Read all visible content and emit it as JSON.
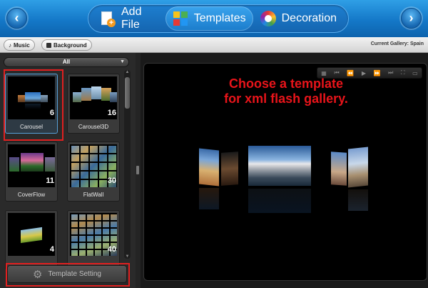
{
  "nav": {
    "back_icon": "chevron-left-icon",
    "forward_icon": "chevron-right-icon"
  },
  "tabs": [
    {
      "label": "Add File",
      "icon": "add-file-icon"
    },
    {
      "label": "Templates",
      "icon": "templates-icon",
      "active": true
    },
    {
      "label": "Decoration",
      "icon": "decoration-icon"
    }
  ],
  "subbar": {
    "music_label": "Music",
    "background_label": "Background",
    "gallery_label": "Current Gallery: Spain"
  },
  "filter": {
    "selected": "All"
  },
  "templates": [
    {
      "name": "Carousel",
      "count": "6",
      "selected": true
    },
    {
      "name": "Carousel3D",
      "count": "16"
    },
    {
      "name": "CoverFlow",
      "count": "11"
    },
    {
      "name": "FlatWall",
      "count": "30"
    },
    {
      "name": "",
      "count": "4"
    },
    {
      "name": "",
      "count": "40"
    }
  ],
  "setting_button": {
    "label": "Template Setting"
  },
  "preview": {
    "hint_line1": "Choose a template",
    "hint_line2": "for xml flash gallery."
  },
  "colors": {
    "accent": "#1478c8",
    "highlight": "#e02020"
  }
}
